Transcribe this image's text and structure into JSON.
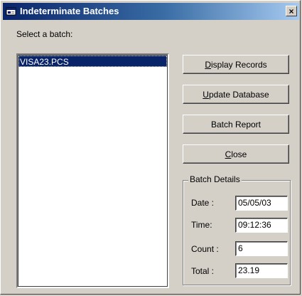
{
  "window": {
    "title": "Indeterminate Batches",
    "close_glyph": "×",
    "icon": "app-window-icon"
  },
  "batch_select": {
    "label": "Select a batch:",
    "items": [
      "VISA23.PCS"
    ],
    "selected_index": 0
  },
  "buttons": {
    "display_records": {
      "prefix": "",
      "accel": "D",
      "rest": "isplay Records"
    },
    "update_database": {
      "prefix": "",
      "accel": "U",
      "rest": "pdate Database"
    },
    "batch_report": {
      "label": "Batch Report"
    },
    "close": {
      "prefix": "",
      "accel": "C",
      "rest": "lose"
    }
  },
  "batch_details": {
    "legend": "Batch Details",
    "date_label": "Date :",
    "date_value": "05/05/03",
    "time_label": "Time:",
    "time_value": "09:12:36",
    "count_label": "Count :",
    "count_value": "6",
    "total_label": "Total :",
    "total_value": "23.19"
  },
  "colors": {
    "titlebar_start": "#0a246a",
    "titlebar_end": "#a6caf0",
    "face": "#d4d0c8",
    "selection": "#0a246a"
  }
}
